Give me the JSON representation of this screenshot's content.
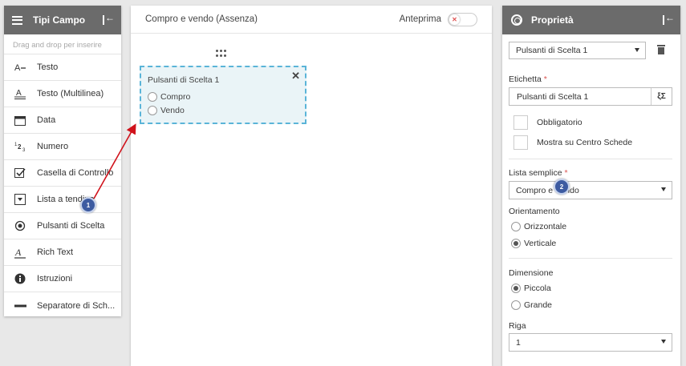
{
  "left_panel": {
    "title": "Tipi Campo",
    "hint": "Drag and drop per inserire",
    "items": [
      {
        "label": "Testo",
        "icon": "text-line-icon"
      },
      {
        "label": "Testo (Multilinea)",
        "icon": "multiline-text-icon"
      },
      {
        "label": "Data",
        "icon": "calendar-icon"
      },
      {
        "label": "Numero",
        "icon": "number-icon"
      },
      {
        "label": "Casella di Controllo",
        "icon": "checkbox-icon"
      },
      {
        "label": "Lista a tendina",
        "icon": "dropdown-icon"
      },
      {
        "label": "Pulsanti di Scelta",
        "icon": "radio-icon"
      },
      {
        "label": "Rich Text",
        "icon": "rich-text-icon"
      },
      {
        "label": "Istruzioni",
        "icon": "info-icon"
      },
      {
        "label": "Separatore di Sch...",
        "icon": "separator-icon"
      }
    ]
  },
  "center": {
    "title": "Compro e vendo (Assenza)",
    "preview_label": "Anteprima",
    "preview_on": false,
    "card": {
      "title": "Pulsanti di Scelta 1",
      "options": [
        "Compro",
        "Vendo"
      ]
    }
  },
  "right_panel": {
    "title": "Proprietà",
    "field_select": "Pulsanti di Scelta 1",
    "etichetta_label": "Etichetta",
    "etichetta_value": "Pulsanti di Scelta 1",
    "fx_glyph": "ξΣ",
    "obbligatorio": "Obbligatorio",
    "mostra": "Mostra su Centro Schede",
    "lista_label": "Lista semplice",
    "lista_value": "Compro e Vendo",
    "orient_label": "Orientamento",
    "orient_options": [
      "Orizzontale",
      "Verticale"
    ],
    "orient_selected": "Verticale",
    "dim_label": "Dimensione",
    "dim_options": [
      "Piccola",
      "Grande"
    ],
    "dim_selected": "Piccola",
    "riga_label": "Riga",
    "riga_value": "1",
    "required_mark": "*"
  },
  "annotations": {
    "badge1": "1",
    "badge2": "2",
    "arrow_color": "#d0121b",
    "badge_color": "#3d5ba1"
  }
}
